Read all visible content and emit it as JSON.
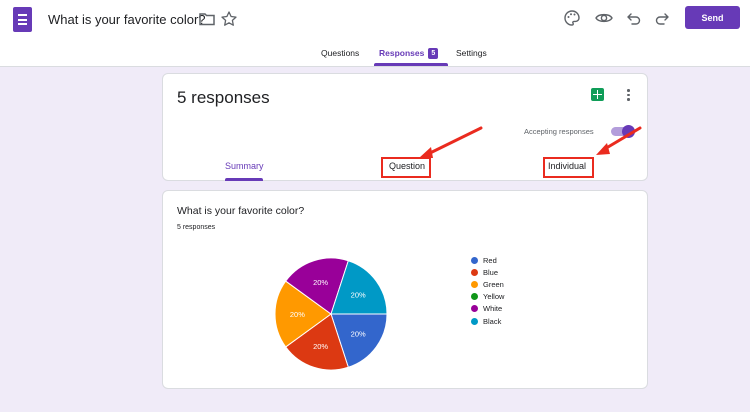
{
  "header": {
    "app_icon": "forms-list-icon",
    "doc_title": "What is your favorite color?",
    "folder_icon": "folder-icon",
    "star_icon": "star-icon",
    "tools": [
      "palette-icon",
      "eye-icon",
      "undo-icon",
      "redo-icon"
    ],
    "send_label": "Send"
  },
  "tabs": {
    "questions": "Questions",
    "responses": "Responses",
    "responses_badge": "5",
    "settings": "Settings"
  },
  "summary_card": {
    "responses_title": "5 responses",
    "accepting_label": "Accepting responses",
    "accepting": true,
    "sub_tabs": {
      "summary": "Summary",
      "question": "Question",
      "individual": "Individual"
    }
  },
  "question_card": {
    "title": "What is your favorite color?",
    "subtitle": "5 responses"
  },
  "colors": {
    "accent": "#673ab7",
    "annotation": "#ea2b1f"
  },
  "chart_data": {
    "type": "pie",
    "categories": [
      "Red",
      "Blue",
      "Green",
      "Yellow",
      "White",
      "Black"
    ],
    "values": [
      20,
      20,
      20,
      0,
      20,
      20
    ],
    "slice_colors": [
      "#3366cc",
      "#dc3912",
      "#ff9900",
      "#109618",
      "#990099",
      "#0099c6"
    ],
    "slice_labels": [
      "20%",
      "20%",
      "20%",
      "",
      "20%",
      "20%"
    ],
    "legend": "right"
  }
}
